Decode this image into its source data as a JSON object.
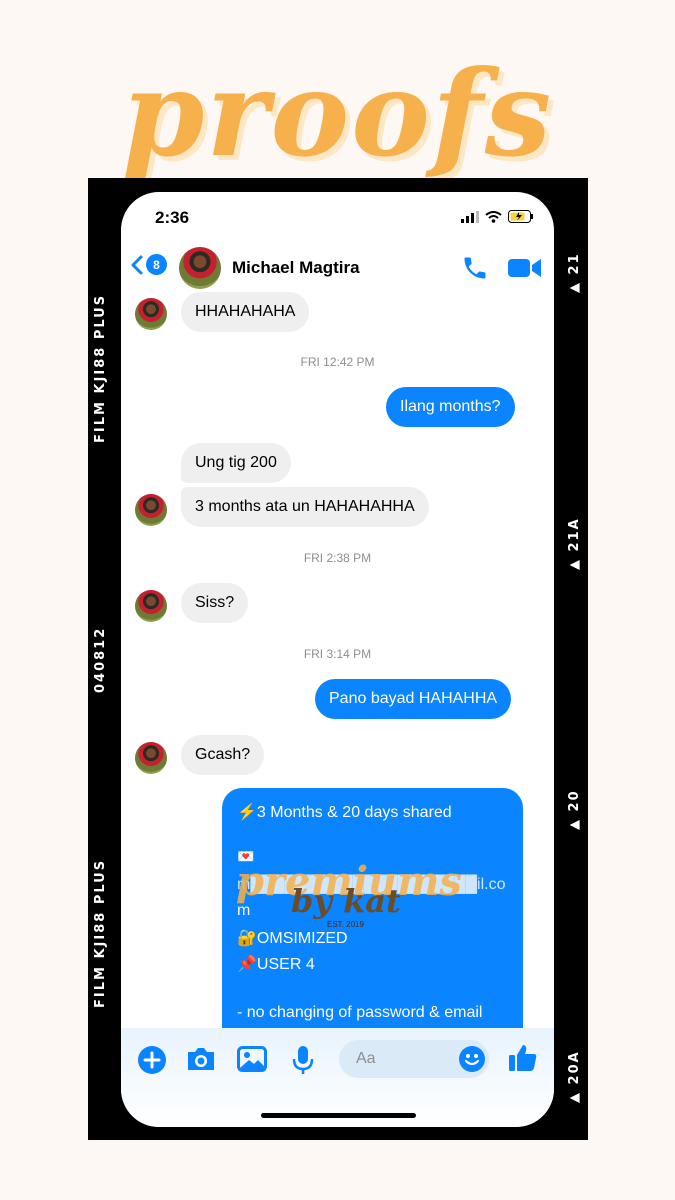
{
  "title": "proofs",
  "film": {
    "left_top": "FILM KJI88 PLUS",
    "left_mid": "040812",
    "left_bottom": "FILM KJI88 PLUS",
    "right_1": "21",
    "right_2": "21A",
    "right_3": "20",
    "right_4": "20A"
  },
  "status": {
    "time": "2:36"
  },
  "header": {
    "back_count": "8",
    "contact_name": "Michael Magtira"
  },
  "messages": {
    "m1": "HHAHAHAHA",
    "t1": "FRI 12:42 PM",
    "m2": "Ilang months?",
    "m3": "Ung tig 200",
    "m4": "3 months ata un HAHAHAHHA",
    "t2": "FRI 2:38 PM",
    "m5": "Siss?",
    "t3": "FRI 3:14 PM",
    "m6": "Pano bayad HAHAHHA",
    "m7": "Gcash?"
  },
  "details": {
    "line1": "⚡️3 Months & 20 days shared",
    "line2": "💌",
    "line3": "m████████████████████il.co",
    "line4": "m",
    "line5": "🔐OMSIMIZED",
    "line6": "📌USER 4",
    "line7": "- no changing of password & email"
  },
  "watermark": {
    "line1": "premiums",
    "line2": "by kat",
    "small": "EST. 2019"
  },
  "composer": {
    "placeholder": "Aa"
  },
  "colors": {
    "accent": "#0a84ff",
    "title": "#f6b14c"
  }
}
